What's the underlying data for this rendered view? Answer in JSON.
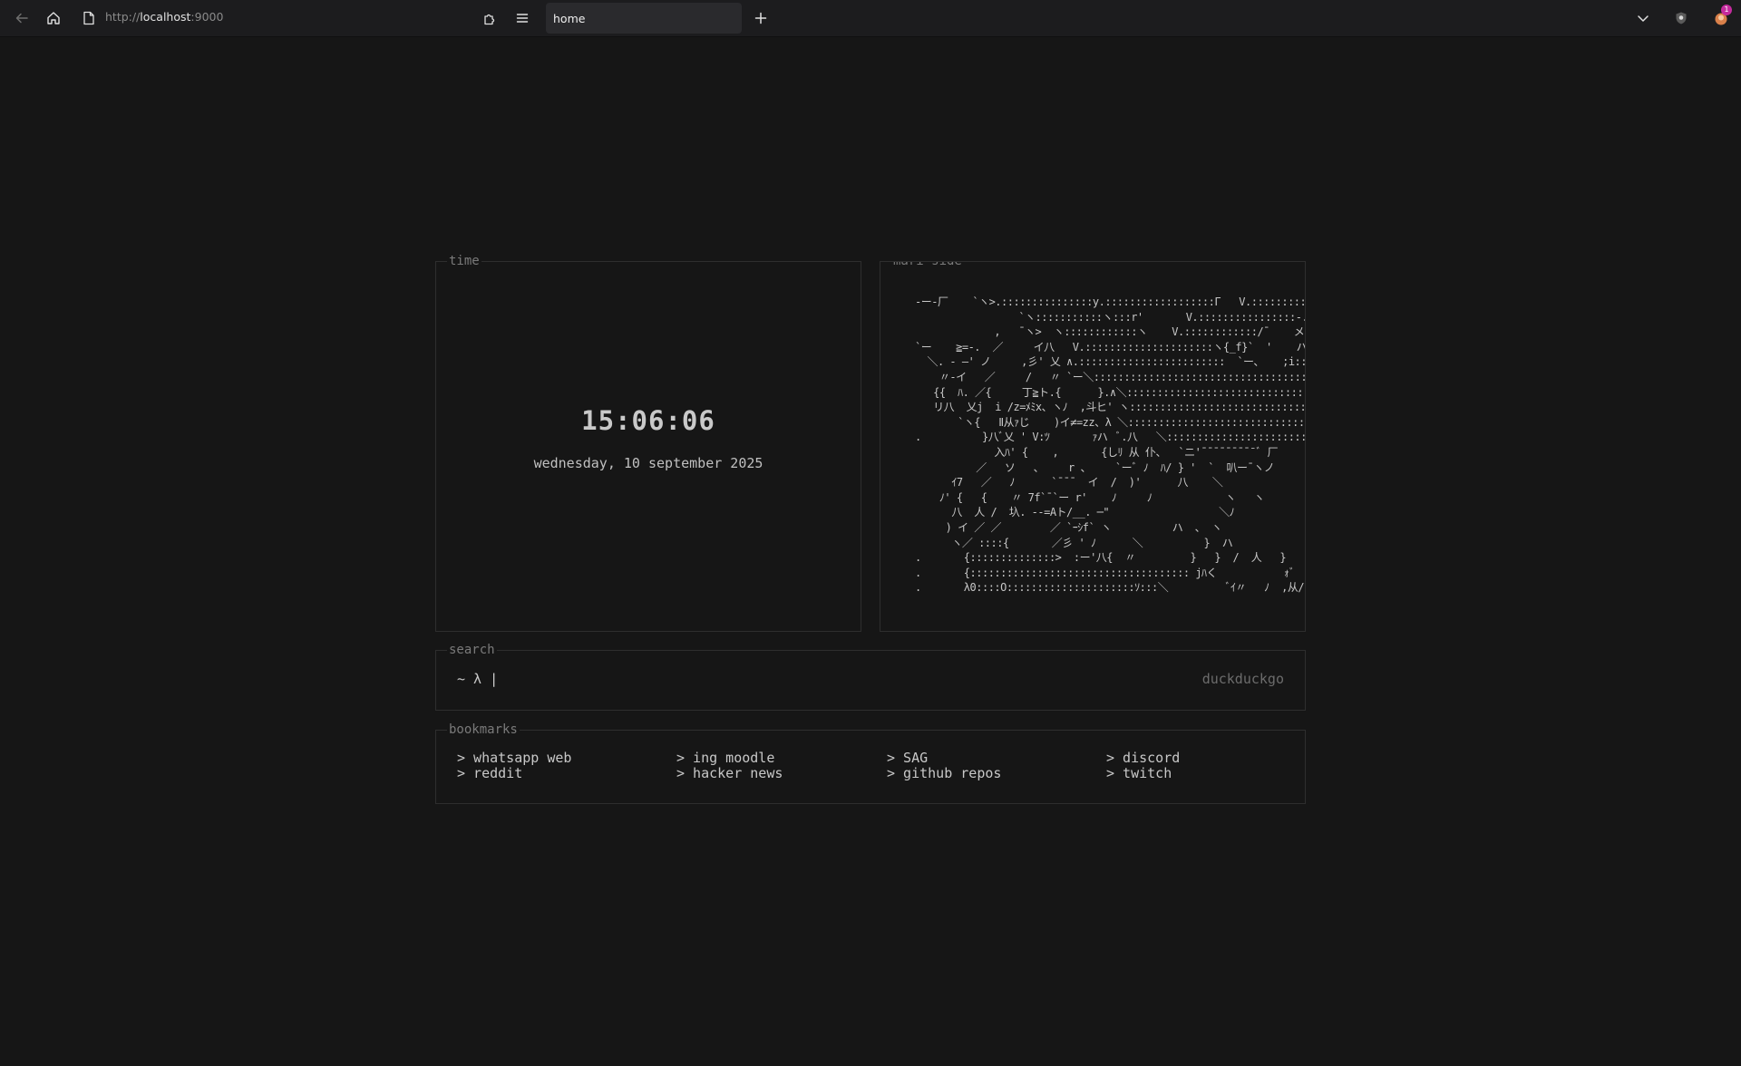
{
  "browser": {
    "url_scheme": "http://",
    "url_host": "localhost",
    "url_port": ":9000",
    "tab_title": "home",
    "extension_badge": "1"
  },
  "time_panel": {
    "legend": "time",
    "clock": "15:06:06",
    "date": "wednesday, 10 september 2025"
  },
  "art_panel": {
    "legend": "mari side",
    "ascii": "-ー‐厂    `ヽ>.:::::::::::::::у.::::::::::::::::::Г   V.:::::::::::::::::::::`ー-―  ,\n                 `ヽ:::::::::::ヽ:::r'       V.::::::::::::::::-.:::: ,-―:::!\n             ,   ¯ヽ>  ヽ::::::::::::ヽ    V.::::::::::::/¯    メ::!\n`ー    ≧=-.  ／     イ八   V.:::::::::::::::::::::ヽ{_f}`  '    ハ:::,\n  ＼. - ―' ノ     ,彡' 乂 ∧.::::::::::::::::::::::::  `ー、   ;i::/\n    〃-イ   ／     /   〃 `ー＼::::::::::::::::::::::::::::::::::::ヽ.{.ﾉ'\n   {{  ﾊ. ／{     丁≧ト.{      }.∧＼::::::::::::::::::::::::::::::::::::::`\n   リ八  乂j  i /z=ﾒﾐx、ヽﾉ  ,斗ヒ' ヽ::::::::::::::::::::::::::::::::::::::::::::＼\n       `ヽ{   Ⅱ从ｧじ    )イ≠=zz、λ ＼:::::::::::::::::::::::::::::::::::::::::::::`ｰｧ\n.          }八ﾞ乂 ' V:ﾂ       ｧハ  ﾞ.八   ＼::::::::::::::::::::::::::::::::::::_/\n             入ﾊ' {    ,       {しﾘ 从 仆、  `ニ'¯¯¯¯¯¯¯¯¯ﾞ 厂\n          ／   ソ   、    r 、    `ーﾞ ﾉ  ﾊ/ } '  `  叭ー¯ヽノ\n      ｲ7   ／   ﾉ      `¯¯¯  イ  /  )'      八    ＼\n    ﾉ' {   {    〃 7f`¯`ー r'    ﾉ     ﾉ            ヽ   ヽ\n      八  人 /  圦. --=Aト/__. ─\"                  ＼ﾉ\n     ) イ ／ ／        ／ `ｰｼf` ヽ          ハ  、 ヽ\n      ヽ／ ::::{       ／彡 ' ﾉ      ＼          }  ハ\n.       {::::::::::::::>  :ー'八{  〃         }   }  /  人   }\n.       {:::::::::::::::::::::::::::::::::::: jﾊく           ｫﾞ  /   |     ｲ   ヽノ\n.       λ0::::O:::::::::::::::::::::ｿ:::＼          ﾞｲ〃   ﾉ  ,从/   ﾉ'"
  },
  "search_panel": {
    "legend": "search",
    "prompt": "~ λ ",
    "caret": "|",
    "engine": "duckduckgo"
  },
  "bookmarks_panel": {
    "legend": "bookmarks",
    "items": [
      "> whatsapp web",
      "> ing moodle",
      "> SAG",
      "> discord",
      "> reddit",
      "> hacker news",
      "> github repos",
      "> twitch"
    ]
  },
  "icons": {
    "back": "back-arrow-icon",
    "home": "home-icon",
    "page": "page-icon",
    "extensions": "puzzle-icon",
    "menu": "hamburger-menu-icon",
    "new_tab": "plus-icon",
    "tab_list": "chevron-down-icon",
    "shield": "shield-extension-icon",
    "avatar": "avatar-extension-icon"
  },
  "colors": {
    "background": "#161616",
    "toolbar": "#1c1c1e",
    "border": "#2e2e2e",
    "legend": "#7a7a7a",
    "text": "#c8c8c8",
    "muted": "#6c6c6c",
    "badge": "#c42b9e"
  }
}
